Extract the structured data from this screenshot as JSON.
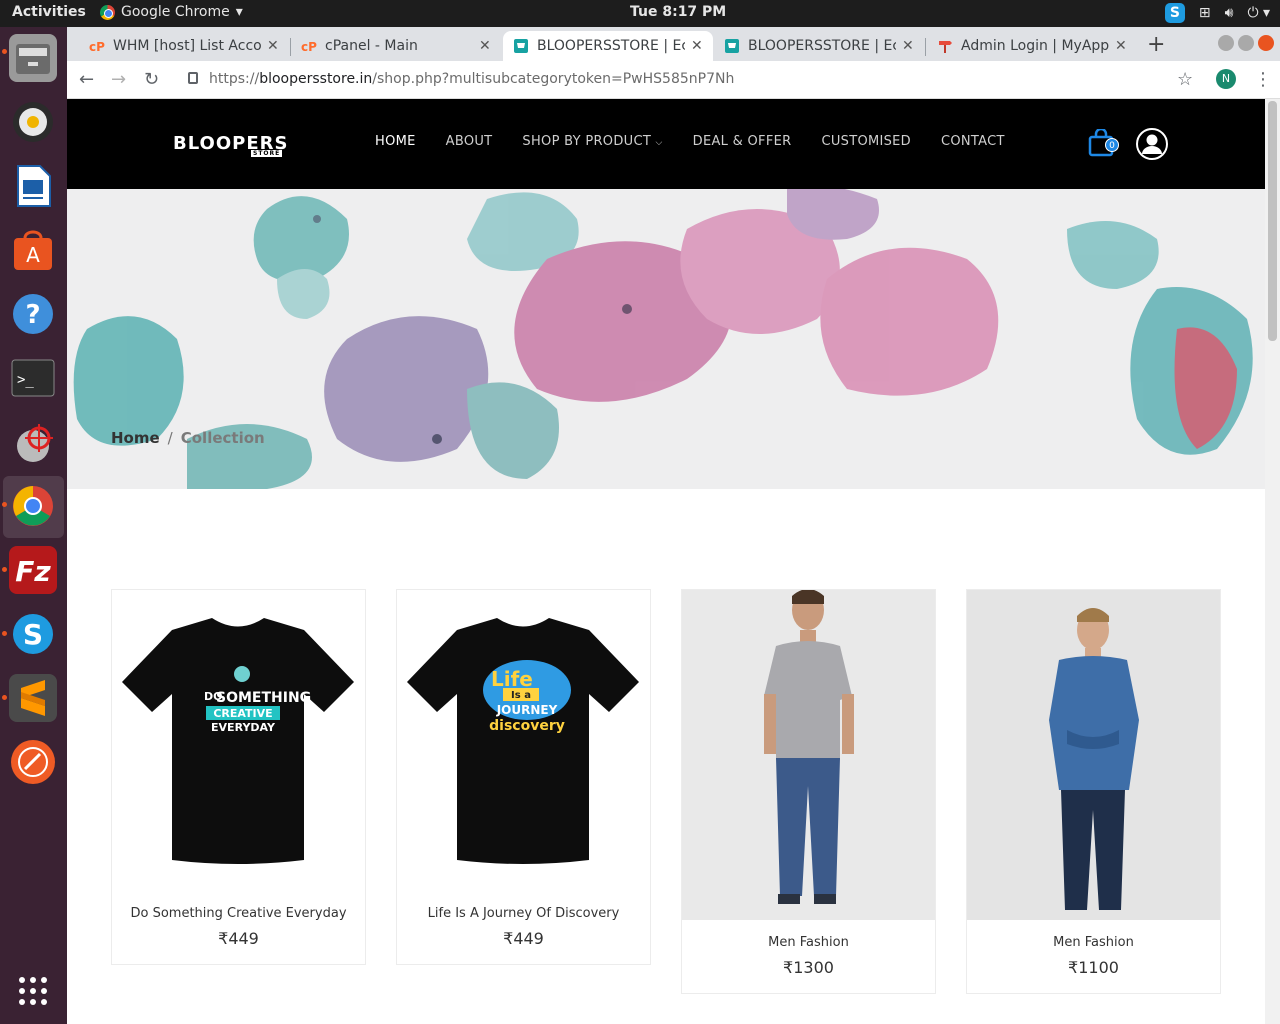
{
  "system": {
    "activities": "Activities",
    "app_name": "Google Chrome",
    "clock": "Tue  8:17 PM"
  },
  "tabs": [
    {
      "title": "WHM [host] List Acco",
      "favicon": "cpanel-icon"
    },
    {
      "title": "cPanel - Main",
      "favicon": "cpanel-icon"
    },
    {
      "title": "BLOOPERSSTORE | Ec",
      "favicon": "cart-icon"
    },
    {
      "title": "BLOOPERSSTORE | Ec",
      "favicon": "cart-icon"
    },
    {
      "title": "Admin Login | MyApp",
      "favicon": "signpost-icon"
    }
  ],
  "address": {
    "scheme": "https://",
    "host": "bloopersstore.in",
    "path": "/shop.php?multisubcategorytoken=PwHS585nP7Nh",
    "profile_initial": "N"
  },
  "site": {
    "logo": "BLOOPERS",
    "logo_sub": "STORE",
    "menu": [
      "HOME",
      "ABOUT",
      "SHOP BY PRODUCT",
      "DEAL & OFFER",
      "CUSTOMISED",
      "CONTACT"
    ],
    "cart_count": "0",
    "breadcrumb": {
      "home": "Home",
      "sep": "/",
      "current": "Collection"
    },
    "products": [
      {
        "name": "Do Something Creative Everyday",
        "price": "₹449",
        "print_lines": [
          "DO",
          "SOMETHING",
          "CREATIVE",
          "EVERYDAY"
        ]
      },
      {
        "name": "Life Is A Journey Of Discovery",
        "price": "₹449",
        "print_lines": [
          "Life",
          "Is a",
          "JOURNEY",
          "discovery"
        ]
      },
      {
        "name": "Men Fashion",
        "price": "₹1300"
      },
      {
        "name": "Men Fashion",
        "price": "₹1100"
      }
    ]
  },
  "colors": {
    "header_bg": "#000000",
    "accent_blue": "#1e88e5",
    "dock_bg": "#3a2233"
  }
}
